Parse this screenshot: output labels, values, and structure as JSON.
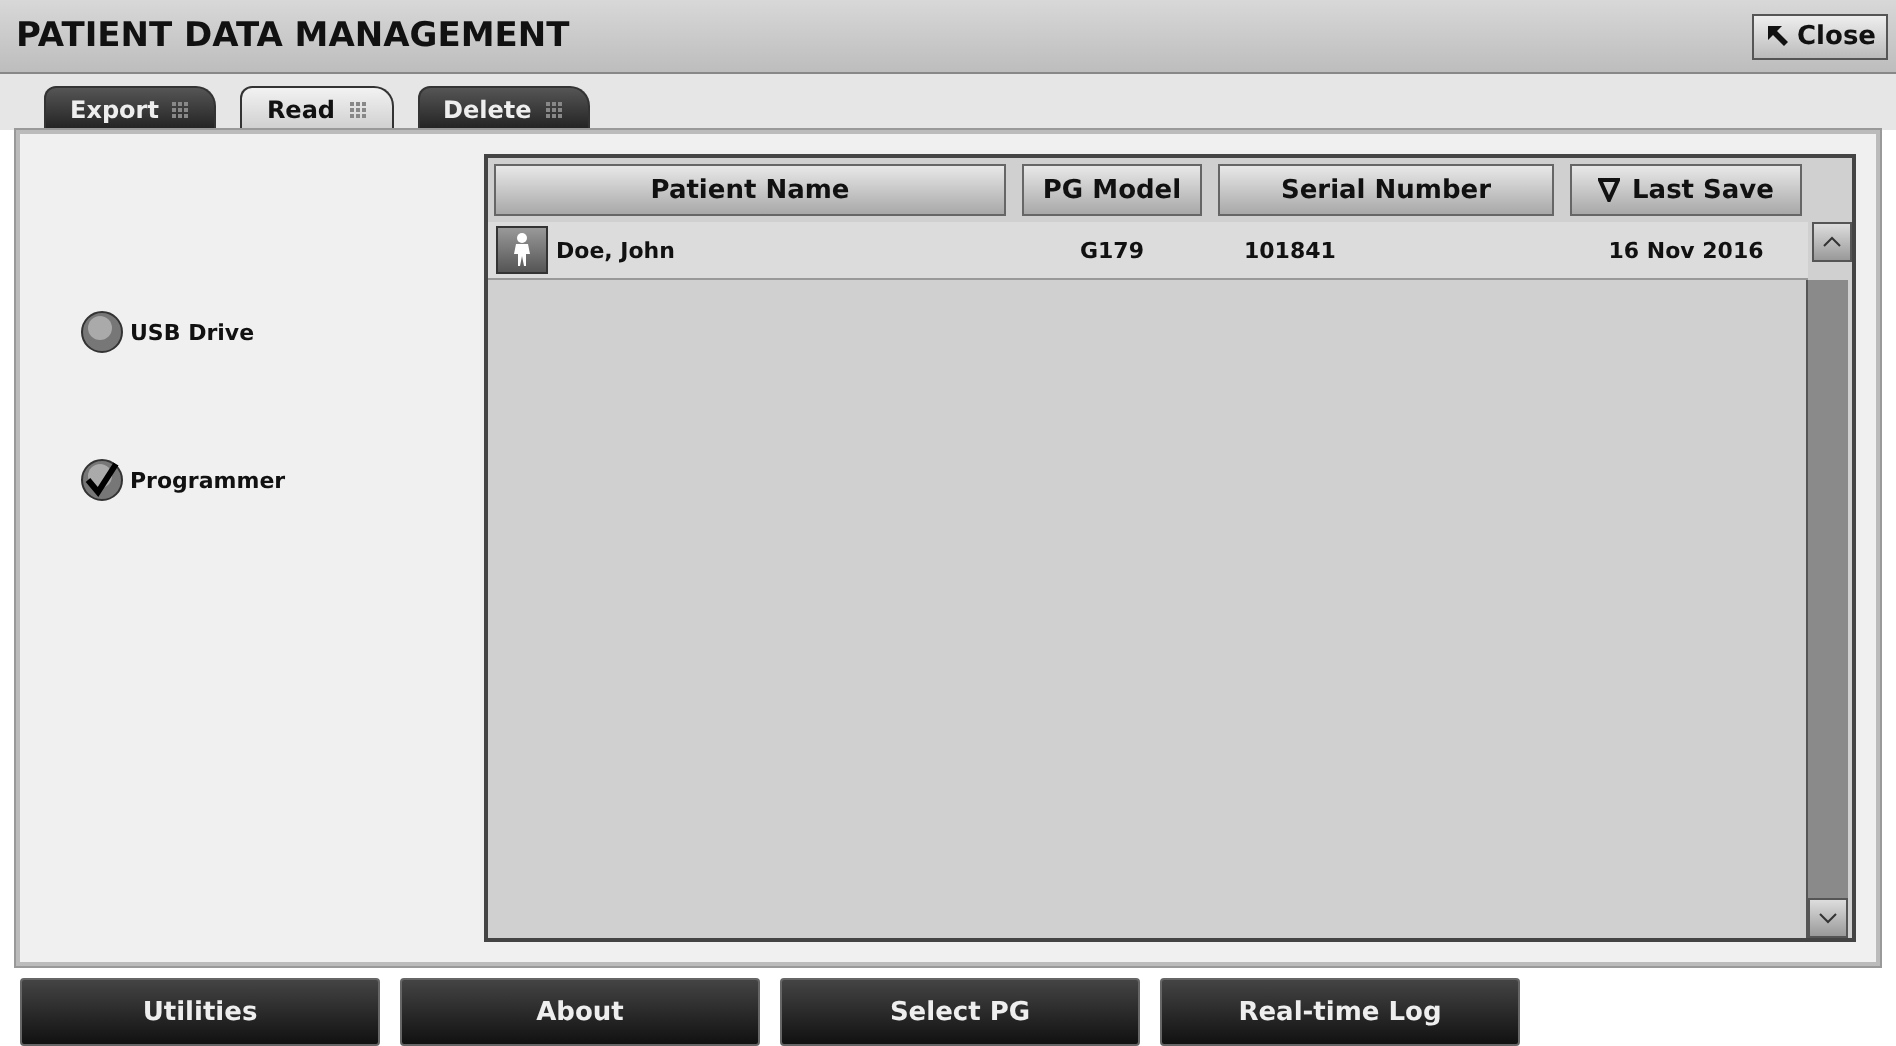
{
  "window": {
    "title": "PATIENT DATA MANAGEMENT",
    "close_label": "Close"
  },
  "tabs": [
    {
      "label": "Export",
      "selected": false
    },
    {
      "label": "Read",
      "selected": true
    },
    {
      "label": "Delete",
      "selected": false
    }
  ],
  "sources": [
    {
      "label": "USB Drive",
      "selected": false
    },
    {
      "label": "Programmer",
      "selected": true
    }
  ],
  "table": {
    "columns": [
      {
        "label": "Patient Name",
        "sorted": false
      },
      {
        "label": "PG Model",
        "sorted": false
      },
      {
        "label": "Serial Number",
        "sorted": false
      },
      {
        "label": "Last Save",
        "sorted": true
      }
    ],
    "rows": [
      {
        "patient_name": "Doe, John",
        "pg_model": "G179",
        "serial_number": "101841",
        "last_save": "16 Nov 2016"
      }
    ]
  },
  "bottom_buttons": [
    "Utilities",
    "About",
    "Select PG",
    "Real-time Log"
  ]
}
